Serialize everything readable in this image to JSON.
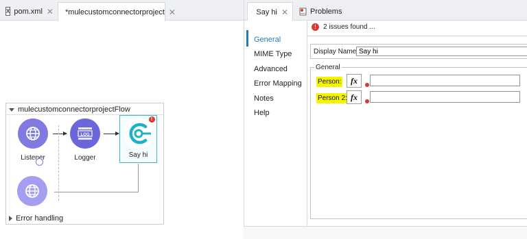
{
  "left_editor": {
    "tabs": [
      {
        "label": "pom.xml",
        "icon": "xml-file-icon",
        "closable": true
      },
      {
        "label": "*mulecustomconnectorproject",
        "icon": "mule-project-icon",
        "closable": true,
        "active": true
      }
    ],
    "flow": {
      "name": "mulecustomconnectorprojectFlow",
      "nodes": [
        {
          "label": "Listener",
          "icon": "globe-icon",
          "color": "#7f79e0"
        },
        {
          "label": "Logger",
          "icon": "log-icon",
          "color": "#6b66d9"
        },
        {
          "label": "Say hi",
          "icon": "custom-connector-icon",
          "color": "#1eb2c8",
          "selected": true,
          "has_error": true
        }
      ],
      "error_handling_label": "Error handling"
    }
  },
  "right_panel": {
    "tabs": [
      {
        "label": "Say hi",
        "icon": "connector-icon",
        "active": true
      },
      {
        "label": "Problems",
        "icon": "problems-icon"
      }
    ],
    "sidebar": {
      "items": [
        "General",
        "MIME Type",
        "Advanced",
        "Error Mapping",
        "Notes",
        "Help"
      ],
      "active": "General"
    },
    "issues_text": "2 issues found ...",
    "issues_count": "2",
    "display_name_label": "Display Name:",
    "display_name_value": "Say hi",
    "general_group_label": "General",
    "params": [
      {
        "label": "Person:",
        "fx": "fx",
        "value": ""
      },
      {
        "label": "Person 2:",
        "fx": "fx",
        "value": ""
      }
    ]
  },
  "colors": {
    "accent": "#1f7bc1",
    "highlight": "#f5f500",
    "error": "#d63b2f",
    "connector": "#1eb2c8",
    "mule_purple": "#7f79e0"
  }
}
